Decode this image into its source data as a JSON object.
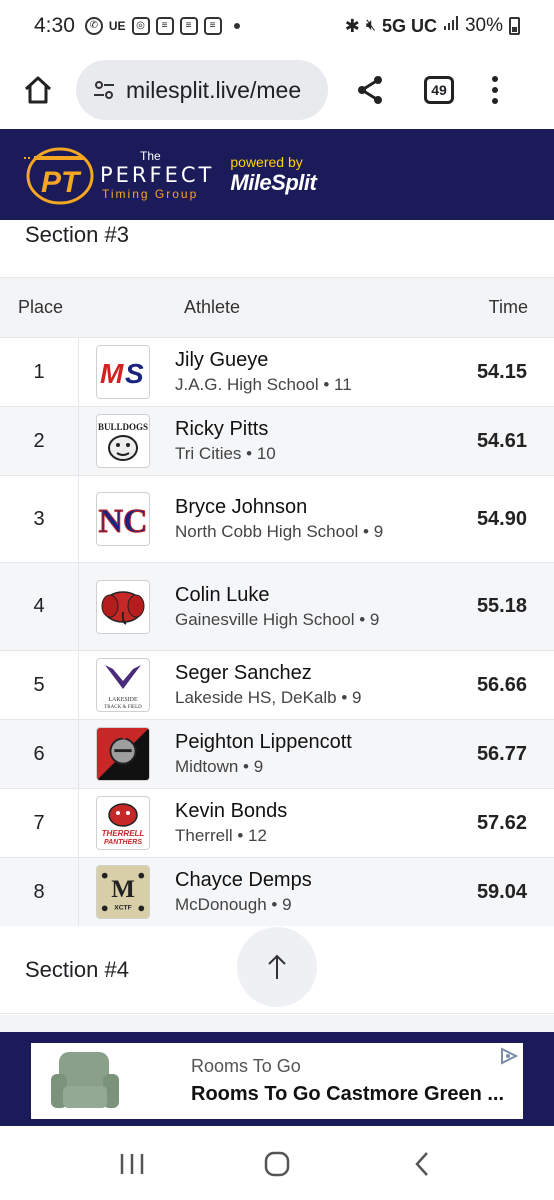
{
  "status_bar": {
    "time": "4:30",
    "left_icons": [
      "whatsapp-icon",
      "ue-icon",
      "toyota-icon",
      "news-icon",
      "news-icon",
      "news-icon"
    ],
    "ue_text": "UE",
    "network": "5G UC",
    "battery": "30%"
  },
  "browser": {
    "url": "milesplit.live/mee",
    "tab_count": "49"
  },
  "banner": {
    "the": "The",
    "perfect": "PERFECT",
    "timing_group": "Timing Group",
    "powered_by": "powered by",
    "milesplit": "MileSplit"
  },
  "results": {
    "section_title": "Section #3",
    "columns": {
      "place": "Place",
      "athlete": "Athlete",
      "time": "Time"
    },
    "rows": [
      {
        "place": "1",
        "name": "Jily Gueye",
        "school": "J.A.G. High School • 11",
        "time": "54.15",
        "logo": "ms-logo"
      },
      {
        "place": "2",
        "name": "Ricky Pitts",
        "school": "Tri Cities • 10",
        "time": "54.61",
        "logo": "bulldogs-logo"
      },
      {
        "place": "3",
        "name": "Bryce Johnson",
        "school": "North Cobb High School • 9",
        "time": "54.90",
        "logo": "nc-logo"
      },
      {
        "place": "4",
        "name": "Colin Luke",
        "school": "Gainesville High School • 9",
        "time": "55.18",
        "logo": "elephant-logo"
      },
      {
        "place": "5",
        "name": "Seger Sanchez",
        "school": "Lakeside HS, DeKalb • 9",
        "time": "56.66",
        "logo": "lakeside-logo"
      },
      {
        "place": "6",
        "name": "Peighton Lippencott",
        "school": "Midtown • 9",
        "time": "56.77",
        "logo": "knight-logo"
      },
      {
        "place": "7",
        "name": "Kevin Bonds",
        "school": "Therrell • 12",
        "time": "57.62",
        "logo": "panther-logo"
      },
      {
        "place": "8",
        "name": "Chayce Demps",
        "school": "McDonough • 9",
        "time": "59.04",
        "logo": "mcdonough-logo"
      }
    ],
    "logo_text": {
      "ms": "MS",
      "bulldogs": "BULLDOGS",
      "nc": "NC",
      "lakeside": "LAKESIDE",
      "lakeside_sub": "TRACK & FIELD",
      "therrell": "THERRELL",
      "panthers": "PANTHERS",
      "m": "M",
      "xctf": "XCTF"
    }
  },
  "section4": {
    "title": "Section #4"
  },
  "ad": {
    "brand": "Rooms To Go",
    "title": "Rooms To Go Castmore Green ..."
  },
  "colors": {
    "banner_bg": "#1b1b5a",
    "accent_orange": "#f5a623",
    "powered_yellow": "#ffd400"
  }
}
